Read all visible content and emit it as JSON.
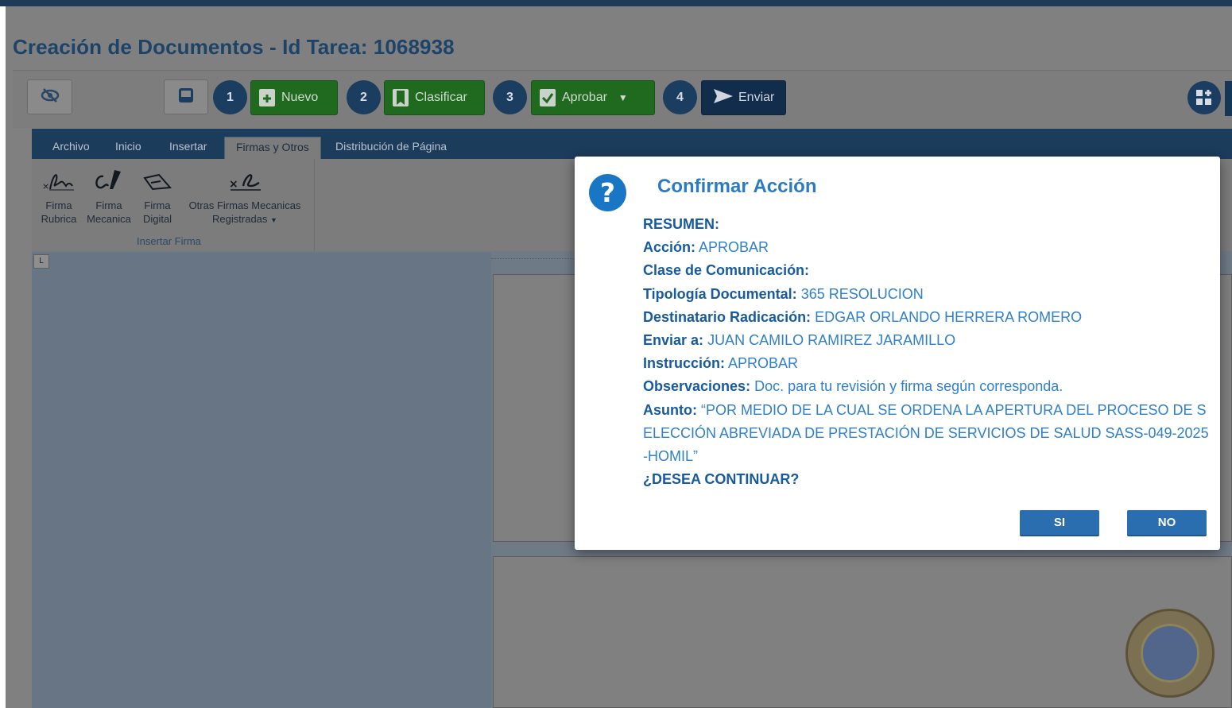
{
  "page": {
    "title": "Creación de Documentos - Id Tarea: 1068938"
  },
  "toolbar": {
    "steps": [
      "1",
      "2",
      "3",
      "4"
    ],
    "new_label": "Nuevo",
    "classify_label": "Clasificar",
    "approve_label": "Aprobar",
    "send_label": "Enviar"
  },
  "ribbon": {
    "tabs": [
      "Archivo",
      "Inicio",
      "Insertar",
      "Firmas y Otros",
      "Distribución de Página"
    ],
    "active_tab": "Firmas y Otros",
    "items": [
      {
        "line1": "Firma",
        "line2": "Rubrica"
      },
      {
        "line1": "Firma",
        "line2": "Mecanica"
      },
      {
        "line1": "Firma",
        "line2": "Digital"
      },
      {
        "line1": "Otras Firmas Mecanicas",
        "line2": "Registradas"
      }
    ],
    "group_label": "Insertar Firma"
  },
  "ruler": {
    "corner": "L"
  },
  "modal": {
    "title": "Confirmar Acción",
    "summary_label": "RESUMEN:",
    "fields": [
      {
        "label": "Acción:",
        "value": "APROBAR"
      },
      {
        "label": "Clase de Comunicación:",
        "value": ""
      },
      {
        "label": "Tipología Documental:",
        "value": "365 RESOLUCION"
      },
      {
        "label": "Destinatario Radicación:",
        "value": "EDGAR ORLANDO HERRERA ROMERO"
      },
      {
        "label": "Enviar a:",
        "value": "JUAN CAMILO RAMIREZ JARAMILLO"
      },
      {
        "label": "Instrucción:",
        "value": "APROBAR"
      },
      {
        "label": "Observaciones:",
        "value": "Doc. para tu revisión y firma según corresponda."
      },
      {
        "label": "Asunto:",
        "value": "“POR MEDIO DE LA CUAL SE ORDENA LA APERTURA DEL PROCESO DE SELECCIÓN ABREVIADA DE PRESTACIÓN DE SERVICIOS DE SALUD SASS-049-2025-HOMIL”"
      }
    ],
    "question": "¿DESEA CONTINUAR?",
    "yes_label": "SI",
    "no_label": "NO"
  },
  "colors": {
    "modal_title": "#2b7bc4",
    "modal_label": "#175a9e",
    "modal_button": "#2a6eb0",
    "approve_green": "#1f6a1f",
    "send_navy": "#122d4c"
  },
  "icons": [
    "eye-slash-icon",
    "inbox-icon",
    "file-plus-icon",
    "bookmark-icon",
    "check-square-icon",
    "caret-down-icon",
    "send-icon",
    "question-circle-icon",
    "signature-icons",
    "apps-icon"
  ]
}
